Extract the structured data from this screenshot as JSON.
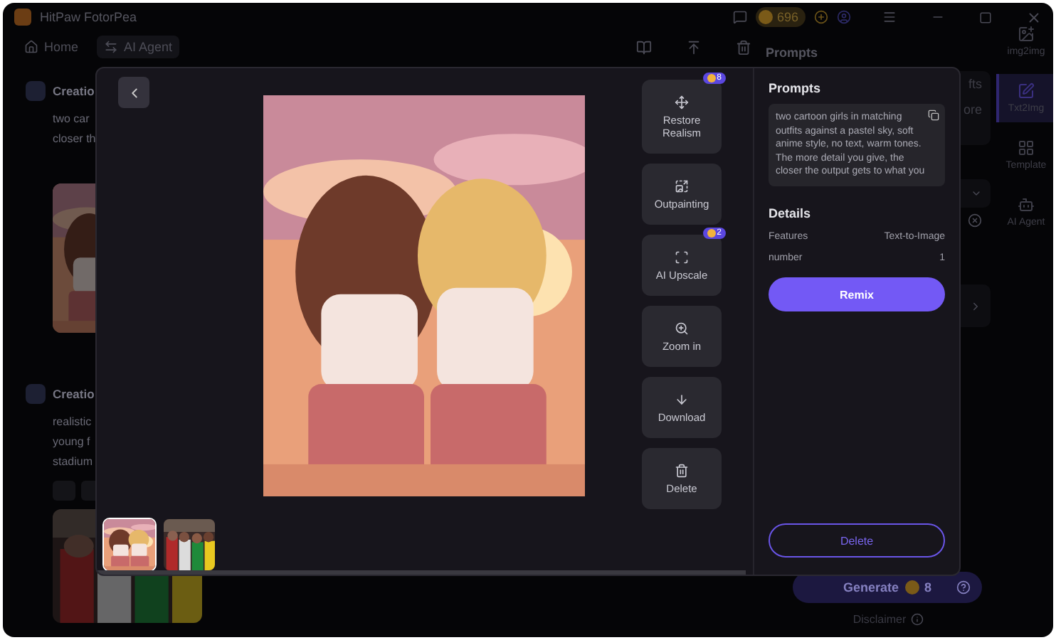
{
  "titlebar": {
    "app_name": "HitPaw FotorPea",
    "credits": "696"
  },
  "toolbar": {
    "tabs": [
      {
        "label": "Home",
        "kind": "home",
        "selected": false
      },
      {
        "label": "AI Agent",
        "kind": "agent",
        "selected": true
      }
    ]
  },
  "feed": [
    {
      "title": "Creatio",
      "lines": [
        "two car",
        "closer th"
      ],
      "image": {
        "kind": "picture"
      }
    },
    {
      "title": "Creatio",
      "lines": [
        "realistic",
        "young f",
        "stadium"
      ],
      "image": {
        "kind": "picture"
      }
    }
  ],
  "side_panel": {
    "title": "Prompts",
    "prompt_lines": [
      "fts",
      "ore"
    ],
    "generate": {
      "label": "Generate",
      "cost": "8"
    },
    "disclaimer": "Disclaimer"
  },
  "nav": [
    {
      "label": "img2img",
      "kind": "img2img",
      "selected": false
    },
    {
      "label": "Txt2Img",
      "kind": "txt2img",
      "selected": true
    },
    {
      "label": "Template",
      "kind": "template",
      "selected": false
    },
    {
      "label": "AI Agent",
      "kind": "agent",
      "selected": false
    }
  ],
  "viewer": {
    "image": {
      "kind": "picture"
    },
    "thumbnails": [
      {
        "kind": "picture",
        "selected": true
      },
      {
        "kind": "picture",
        "selected": false
      }
    ],
    "tools": [
      {
        "label": "Restore Realism",
        "kind": "restore",
        "cost": "8"
      },
      {
        "label": "Outpainting",
        "kind": "outpaint"
      },
      {
        "label": "AI Upscale",
        "kind": "upscale",
        "cost": "2"
      },
      {
        "label": "Zoom in",
        "kind": "zoom"
      },
      {
        "label": "Download",
        "kind": "download"
      },
      {
        "label": "Delete",
        "kind": "delete"
      }
    ],
    "prompts": {
      "title": "Prompts",
      "text": "two cartoon girls in matching outfits against a pastel sky, soft anime style, no text, warm tones. The more detail you give, the closer the output gets to what you"
    },
    "details": {
      "title": "Details",
      "rows": [
        {
          "label": "Features",
          "value": "Text-to-Image"
        },
        {
          "label": "number",
          "value": "1"
        }
      ]
    },
    "remix": "Remix",
    "delete": "Delete"
  }
}
